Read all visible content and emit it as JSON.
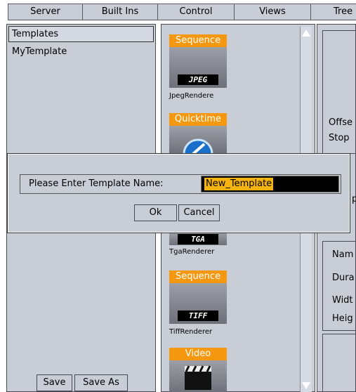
{
  "menu": {
    "tabs": [
      {
        "label": "Server"
      },
      {
        "label": "Built Ins"
      },
      {
        "label": "Control"
      },
      {
        "label": "Views"
      },
      {
        "label": "Tree"
      }
    ]
  },
  "templates_panel": {
    "header": "Templates",
    "items": [
      "MyTemplate"
    ],
    "save_label": "Save",
    "save_as_label": "Save As"
  },
  "renderers": [
    {
      "caption": "Sequence",
      "format": "JPEG",
      "name": "JpegRendere"
    },
    {
      "caption": "Quicktime",
      "format": "",
      "name": ""
    },
    {
      "caption": "",
      "format": "TGA",
      "name": "TgaRenderer"
    },
    {
      "caption": "Sequence",
      "format": "TIFF",
      "name": "TiffRenderer"
    },
    {
      "caption": "Video",
      "format": "",
      "name": ""
    }
  ],
  "properties_panel": {
    "labels": [
      "Offse",
      "Stop",
      "p",
      "Nam",
      "Dura",
      "Widt",
      "Heig"
    ]
  },
  "dialog": {
    "prompt": "Please Enter Template Name:",
    "value": "New_Template",
    "ok_label": "Ok",
    "cancel_label": "Cancel"
  },
  "colors": {
    "panel": "#c9cdd6",
    "caption_orange": "#f5980f",
    "selection": "#f5b30f"
  }
}
